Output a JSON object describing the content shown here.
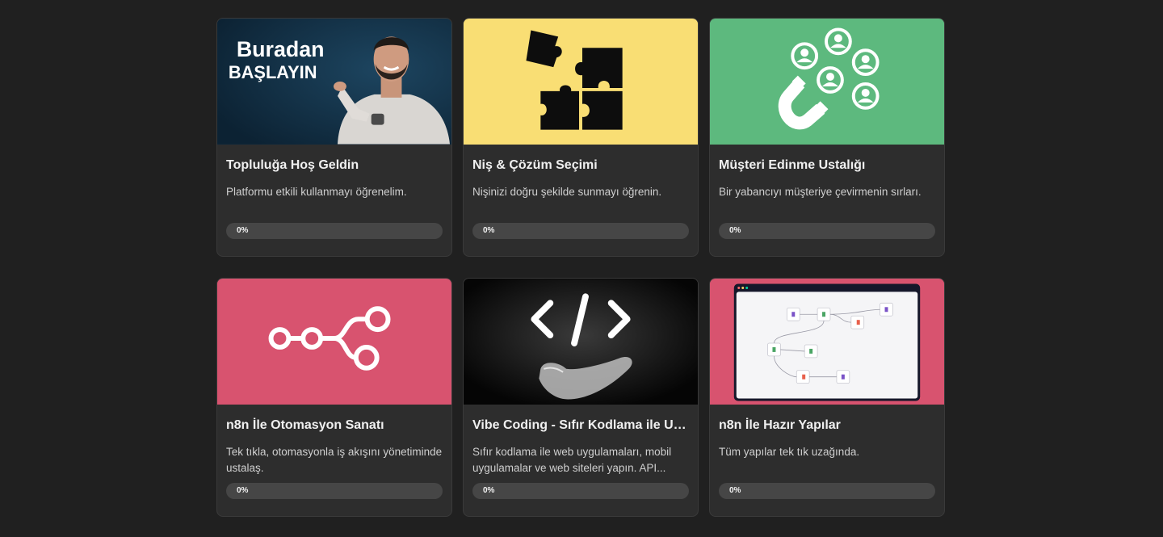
{
  "courses": [
    {
      "title": "Topluluğa Hoş Geldin",
      "description": "Platformu etkili kullanmayı öğrenelim.",
      "progress_percent": 0,
      "progress_label": "0%",
      "thumb": {
        "bg": "#0f2a3d",
        "icon": "presenter-photo",
        "text_line1": "Buradan",
        "text_line2": "BAŞLAYIN"
      }
    },
    {
      "title": "Niş & Çözüm Seçimi",
      "description": "Nişinizi doğru şekilde sunmayı öğrenin.",
      "progress_percent": 0,
      "progress_label": "0%",
      "thumb": {
        "bg": "#f9de74",
        "icon": "puzzle-icon"
      }
    },
    {
      "title": "Müşteri Edinme Ustalığı",
      "description": "Bir yabancıyı müşteriye çevirmenin sırları.",
      "progress_percent": 0,
      "progress_label": "0%",
      "thumb": {
        "bg": "#5db97e",
        "icon": "magnet-users-icon"
      }
    },
    {
      "title": "n8n İle Otomasyon Sanatı",
      "description": "Tek tıkla, otomasyonla iş akışını yönetiminde ustalaş.",
      "progress_percent": 0,
      "progress_label": "0%",
      "thumb": {
        "bg": "#d8536f",
        "icon": "workflow-nodes-icon"
      }
    },
    {
      "title": "Vibe Coding - Sıfır Kodlama ile Uygulama Geliştirme",
      "description": "Sıfır kodlama ile web uygulamaları, mobil uygulamalar ve web siteleri yapın. API...",
      "progress_percent": 0,
      "progress_label": "0%",
      "thumb": {
        "bg": "#050505",
        "icon": "code-hand-icon"
      }
    },
    {
      "title": "n8n İle Hazır Yapılar",
      "description": "Tüm yapılar tek tık uzağında.",
      "progress_percent": 0,
      "progress_label": "0%",
      "thumb": {
        "bg": "#d8536f",
        "icon": "workflow-screenshot"
      }
    }
  ]
}
